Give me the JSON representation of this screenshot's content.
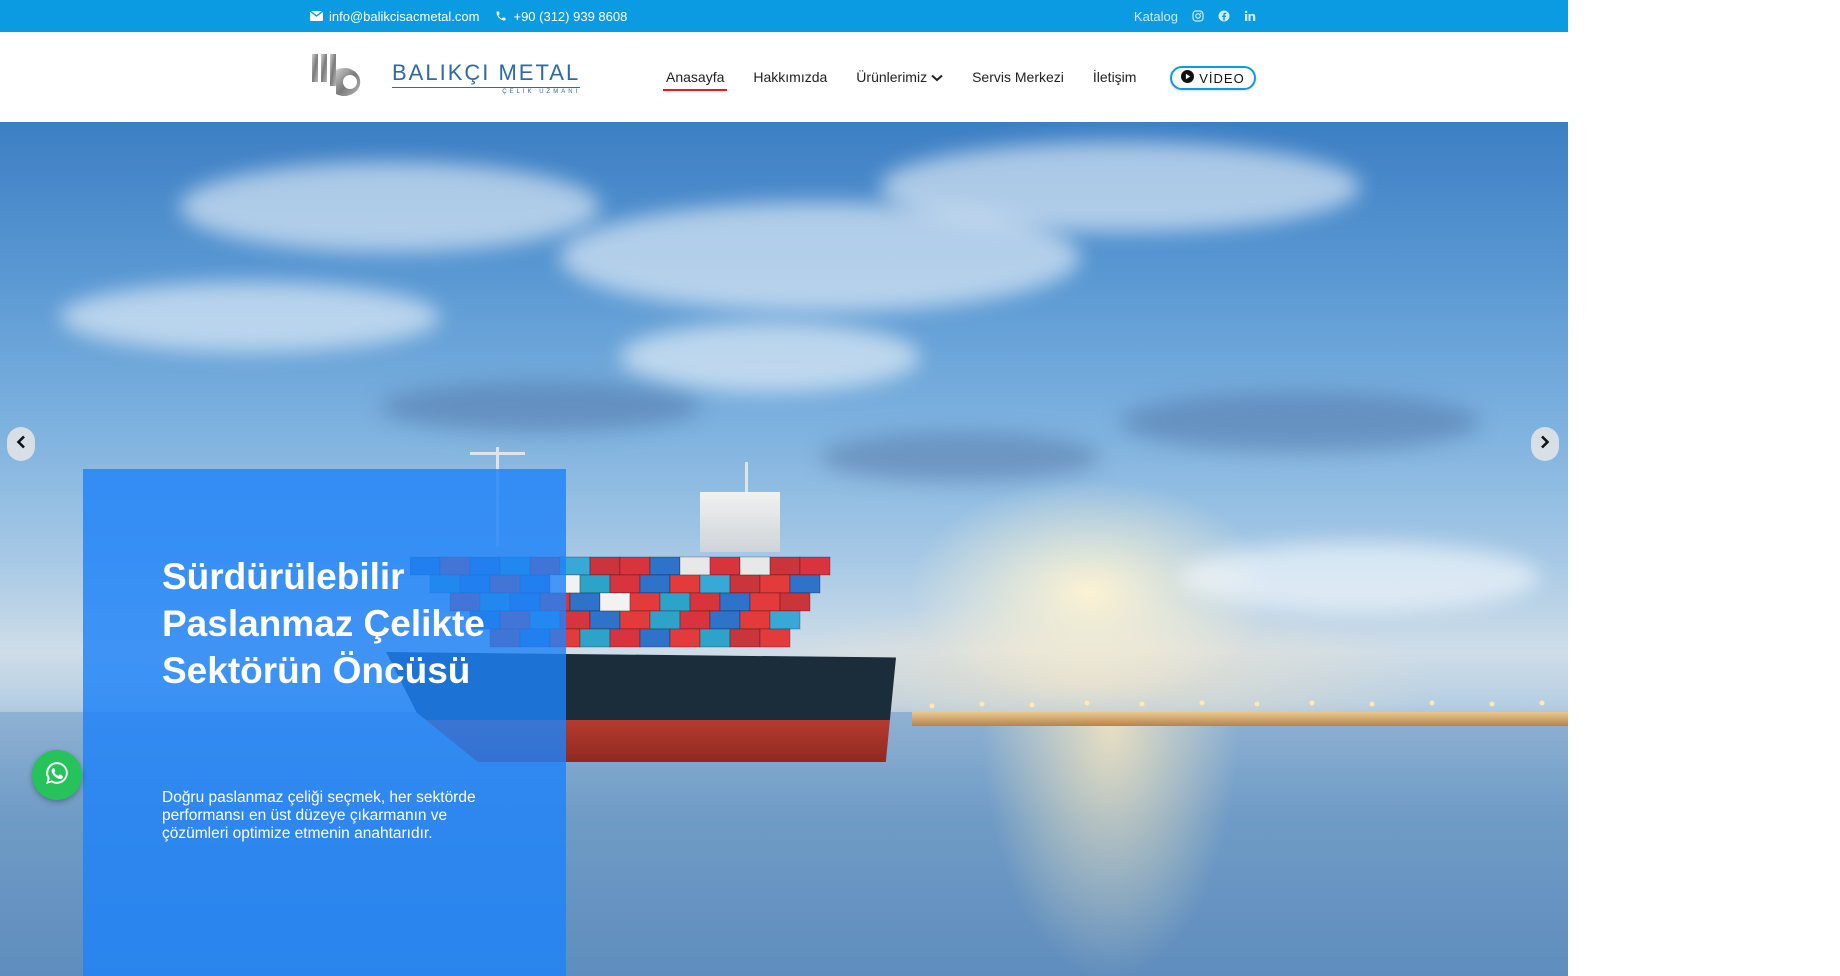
{
  "topbar": {
    "email": "info@balikcisacmetal.com",
    "phone": "+90 (312) 939 8608",
    "katalog": "Katalog",
    "social_icons": [
      "instagram-icon",
      "facebook-icon",
      "linkedin-icon"
    ]
  },
  "header": {
    "logo": {
      "name": "BALIKÇI METAL",
      "subtitle": "ÇELİK UZMANI"
    },
    "nav": [
      {
        "label": "Anasayfa",
        "active": true
      },
      {
        "label": "Hakkımızda"
      },
      {
        "label": "Ürünlerimiz",
        "has_dropdown": true
      },
      {
        "label": "Servis Merkezi"
      },
      {
        "label": "İletişim"
      }
    ],
    "video_button": "VİDEO"
  },
  "hero": {
    "title": "Sürdürülebilir Paslanmaz Çelikte Sektörün Öncüsü",
    "description": "Doğru paslanmaz çeliği seçmek, her sektörde performansı en üst düzeye çıkarmanın ve çözümleri optimize etmenin anahtarıdır."
  },
  "colors": {
    "topbar_bg": "#0b9be3",
    "active_underline": "#e21b2c",
    "panel_bg": "#1e82f8",
    "whatsapp": "#25c35a",
    "brand_blue": "#2d6aa6"
  }
}
